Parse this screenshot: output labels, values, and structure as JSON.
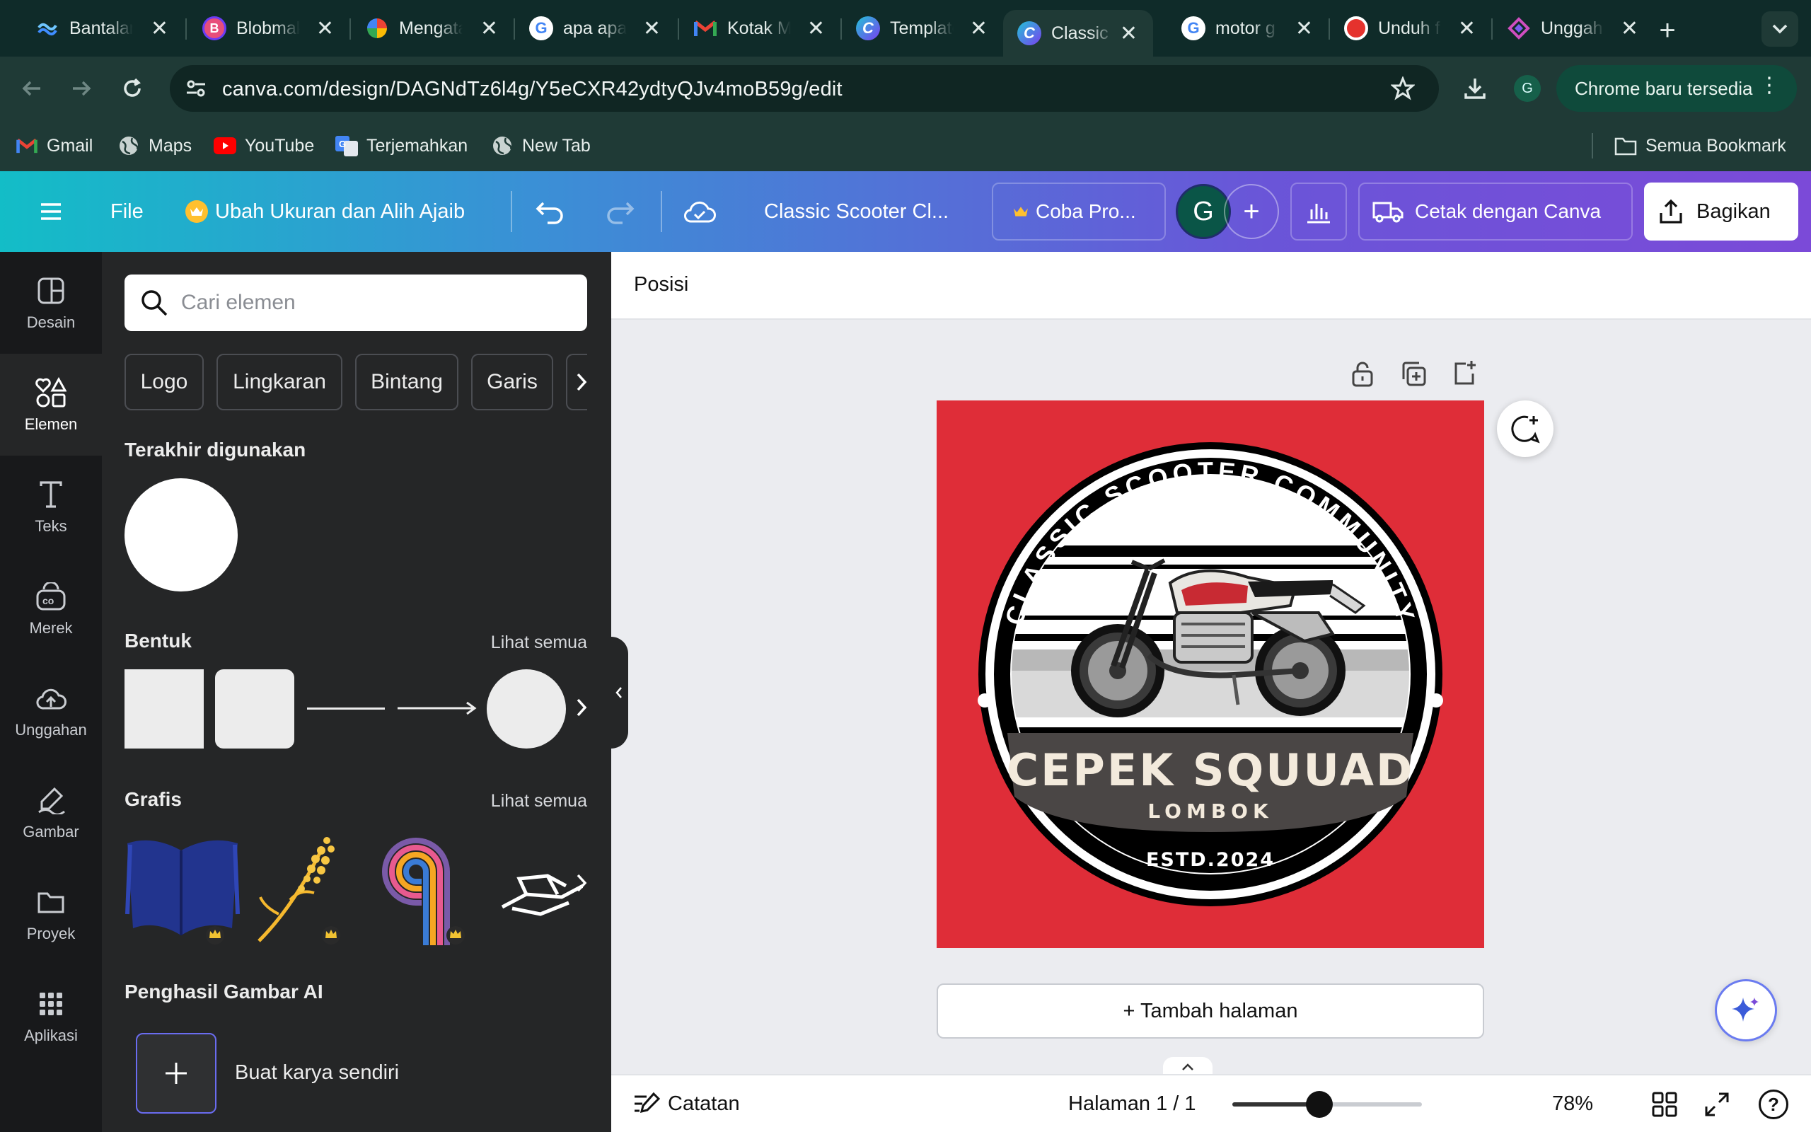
{
  "browser": {
    "tabs": [
      {
        "title": "Bantalan",
        "icon": "wave-favicon-icon"
      },
      {
        "title": "Blobmaker",
        "icon": "blob-favicon-icon"
      },
      {
        "title": "Mengatasi",
        "icon": "pinwheel-favicon-icon"
      },
      {
        "title": "apa apa",
        "icon": "google-favicon-icon"
      },
      {
        "title": "Kotak Masuk",
        "icon": "gmail-favicon-icon"
      },
      {
        "title": "Template",
        "icon": "canva-favicon-icon"
      },
      {
        "title": "Classic",
        "icon": "canva-favicon-icon"
      },
      {
        "title": "motor g",
        "icon": "google-favicon-icon"
      },
      {
        "title": "Unduh f",
        "icon": "downloader-favicon-icon"
      },
      {
        "title": "Unggah",
        "icon": "diamond-favicon-icon"
      }
    ],
    "url": "canva.com/design/DAGNdTz6l4g/Y5eCXR42ydtyQJv4moB59g/edit",
    "profile_initial": "G",
    "update_label": "Chrome baru tersedia",
    "bookmarks": [
      "Gmail",
      "Maps",
      "YouTube",
      "Terjemahkan",
      "New Tab"
    ],
    "all_bookmarks": "Semua Bookmark"
  },
  "header": {
    "file": "File",
    "magic_resize": "Ubah Ukuran dan Alih Ajaib",
    "doc_title": "Classic Scooter Cl...",
    "try_pro": "Coba Pro...",
    "avatar_initial": "G",
    "print": "Cetak dengan Canva",
    "share": "Bagikan"
  },
  "rail": [
    {
      "label": "Desain",
      "icon": "layout-icon"
    },
    {
      "label": "Elemen",
      "icon": "shapes-icon"
    },
    {
      "label": "Teks",
      "icon": "text-icon"
    },
    {
      "label": "Merek",
      "icon": "brand-icon"
    },
    {
      "label": "Unggahan",
      "icon": "cloud-upload-icon"
    },
    {
      "label": "Gambar",
      "icon": "draw-icon"
    },
    {
      "label": "Proyek",
      "icon": "folder-icon"
    },
    {
      "label": "Aplikasi",
      "icon": "apps-grid-icon"
    }
  ],
  "panel": {
    "search_placeholder": "Cari elemen",
    "chips": [
      "Logo",
      "Lingkaran",
      "Bintang",
      "Garis"
    ],
    "recent_title": "Terakhir digunakan",
    "shapes_title": "Bentuk",
    "graphics_title": "Grafis",
    "see_all": "Lihat semua",
    "ai_title": "Penghasil Gambar AI",
    "ai_create": "Buat karya sendiri"
  },
  "canvas": {
    "position_label": "Posisi",
    "add_page": "+ Tambah halaman",
    "logo": {
      "arc_text": "CLASSIC SCOOTER COMMUNITY",
      "title": "CEPEK SQUUAD",
      "subtitle": "LOMBOK",
      "established": "ESTD.2024"
    }
  },
  "status": {
    "notes": "Catatan",
    "page": "Halaman 1 / 1",
    "zoom": "78%",
    "zoom_level": 0.78
  },
  "colors": {
    "design_bg": "#df2d38",
    "logo_cream": "#f3eadc",
    "logo_band": "#4a4645"
  }
}
